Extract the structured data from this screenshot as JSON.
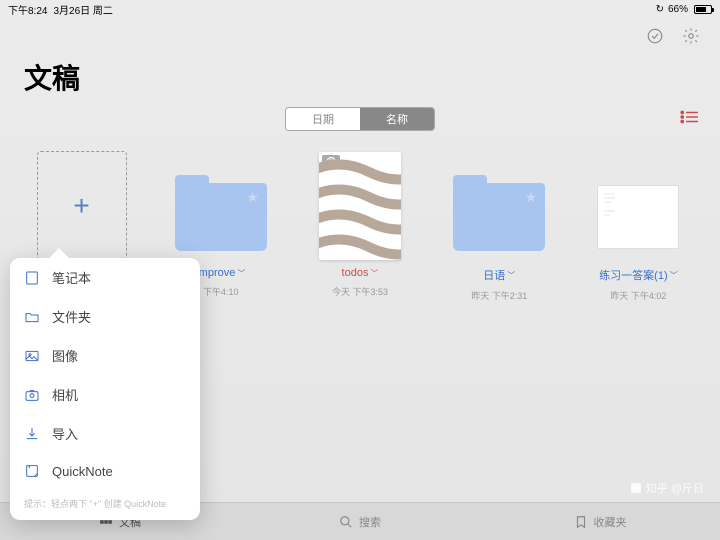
{
  "status": {
    "time": "下午8:24",
    "date": "3月26日 周二",
    "battery": "66%"
  },
  "title": "文稿",
  "seg": {
    "date": "日期",
    "name": "名称"
  },
  "items": [
    {
      "name": "improve",
      "meta": "下午4:10",
      "kind": "folder"
    },
    {
      "name": "todos",
      "meta": "今天 下午3:53",
      "kind": "note"
    },
    {
      "name": "日语",
      "meta": "昨天 下午2:31",
      "kind": "folder"
    },
    {
      "name": "练习一答案(1)",
      "meta": "昨天 下午4:02",
      "kind": "doc"
    }
  ],
  "popover": {
    "items": [
      "笔记本",
      "文件夹",
      "图像",
      "相机",
      "导入",
      "QuickNote"
    ],
    "hint": "提示：轻点两下 \"+\" 创建 QuickNote"
  },
  "tabs": {
    "docs": "文稿",
    "search": "搜索",
    "fav": "收藏夹"
  },
  "watermark": "知乎 @斤日"
}
